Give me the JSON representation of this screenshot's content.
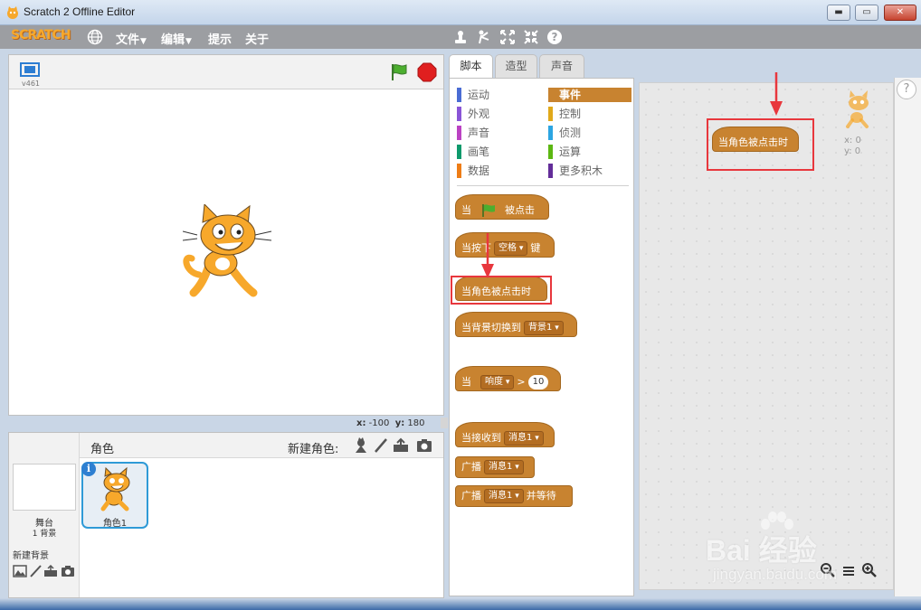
{
  "window": {
    "title": "Scratch 2 Offline Editor",
    "min_glyph": "▬",
    "max_glyph": "▭",
    "close_glyph": "✕"
  },
  "menubar": {
    "logo": "SCRATCH",
    "items": [
      {
        "label": "文件"
      },
      {
        "label": "编辑"
      },
      {
        "label": "提示"
      },
      {
        "label": "关于"
      }
    ],
    "tools": [
      "stamp-icon",
      "cut-icon",
      "grow-icon",
      "shrink-icon",
      "help-icon"
    ]
  },
  "stage": {
    "version": "v461",
    "coords": {
      "x_label": "x:",
      "x": "-100",
      "y_label": "y:",
      "y": "180"
    }
  },
  "sprites": {
    "title": "角色",
    "new_sprite_label": "新建角色:",
    "stage_name": "舞台",
    "stage_backdrops": "1 背景",
    "new_backdrop_label": "新建背景",
    "sprite_list": [
      {
        "name": "角色1",
        "info": "i"
      }
    ]
  },
  "tabs": [
    {
      "label": "脚本",
      "active": true
    },
    {
      "label": "造型",
      "active": false
    },
    {
      "label": "声音",
      "active": false
    }
  ],
  "palette": {
    "categories_left": [
      {
        "label": "运动",
        "color": "#4a6cd4"
      },
      {
        "label": "外观",
        "color": "#8a55d7"
      },
      {
        "label": "声音",
        "color": "#bb42c3"
      },
      {
        "label": "画笔",
        "color": "#0e9a6c"
      },
      {
        "label": "数据",
        "color": "#ee7d16"
      }
    ],
    "categories_right": [
      {
        "label": "事件",
        "color": "#c88330",
        "selected": true
      },
      {
        "label": "控制",
        "color": "#e1a91a"
      },
      {
        "label": "侦测",
        "color": "#2ca5e2"
      },
      {
        "label": "运算",
        "color": "#5cb712"
      },
      {
        "label": "更多积木",
        "color": "#632d99"
      }
    ],
    "blocks": {
      "flag_pre": "当",
      "flag_post": "被点击",
      "key_pre": "当按下",
      "key_dd": "空格",
      "key_post": "键",
      "sprite_clicked": "当角色被点击时",
      "backdrop_pre": "当背景切换到",
      "backdrop_dd": "背景1",
      "sensor_pre": "当",
      "sensor_dd": "响度",
      "sensor_op": ">",
      "sensor_num": "10",
      "receive_pre": "当接收到",
      "receive_dd": "消息1",
      "broadcast_pre": "广播",
      "broadcast_dd": "消息1",
      "broadcast_wait_pre": "广播",
      "broadcast_wait_dd": "消息1",
      "broadcast_wait_post": "并等待"
    }
  },
  "script_area": {
    "placed_block": "当角色被点击时",
    "sprite_x": "x: 0",
    "sprite_y": "y: 0",
    "help": "?"
  },
  "watermark": {
    "brand": "Bai 经验",
    "url": "jingyan.baidu.com"
  },
  "colors": {
    "events": "#c88330",
    "highlight": "#e8373d",
    "selection": "#2e9ad7"
  }
}
